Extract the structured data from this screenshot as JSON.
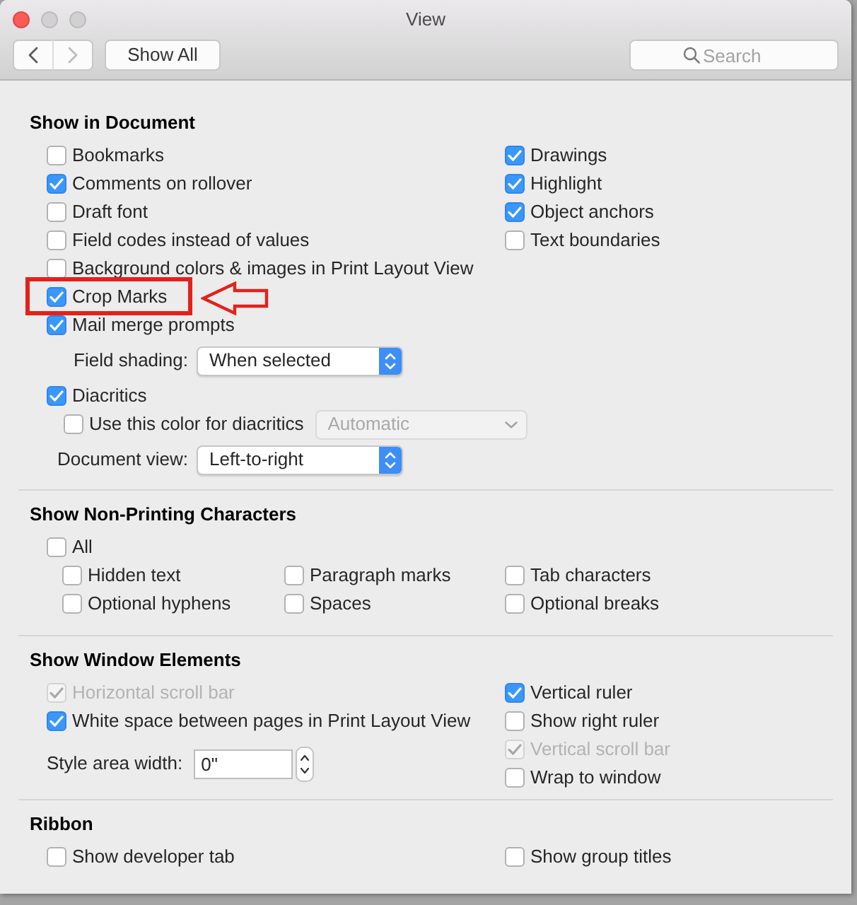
{
  "window": {
    "title": "View",
    "buttons": [
      {
        "kind": "close",
        "disabled": false
      },
      {
        "kind": "minimize",
        "disabled": true
      },
      {
        "kind": "zoom",
        "disabled": true
      }
    ]
  },
  "toolbar": {
    "nav_buttons": [
      {
        "kind": "back",
        "disabled": false
      },
      {
        "kind": "forward",
        "disabled": true
      }
    ],
    "show_all_button": "Show All",
    "search": {
      "placeholder": "Search"
    }
  },
  "sections": [
    {
      "title": "Show in Document",
      "left_items": [
        {
          "kind": "checkbox",
          "label": "Bookmarks",
          "checked": false,
          "highlighted": false
        },
        {
          "kind": "checkbox",
          "label": "Comments on rollover",
          "checked": true,
          "highlighted": false
        },
        {
          "kind": "checkbox",
          "label": "Draft font",
          "checked": false,
          "highlighted": false
        },
        {
          "kind": "checkbox",
          "label": "Field codes instead of values",
          "checked": false,
          "highlighted": false
        },
        {
          "kind": "checkbox",
          "label": "Background colors & images in Print Layout View",
          "checked": false,
          "highlighted": false
        },
        {
          "kind": "checkbox",
          "label": "Crop Marks",
          "checked": true,
          "highlighted": true
        },
        {
          "kind": "checkbox",
          "label": "Mail merge prompts",
          "checked": true,
          "highlighted": false
        },
        {
          "kind": "select",
          "label": "Field shading:",
          "value": "When selected",
          "highlighted": false
        },
        {
          "kind": "checkbox",
          "label": "Diacritics",
          "checked": true,
          "highlighted": false,
          "children": [
            {
              "kind": "checkbox_select",
              "label": "Use this color for diacritics",
              "checked": false,
              "select": {
                "value": "Automatic",
                "disabled": true
              }
            }
          ]
        },
        {
          "kind": "select",
          "label": "Document view:",
          "value": "Left-to-right",
          "highlighted": false
        }
      ],
      "right_items": [
        {
          "kind": "checkbox",
          "label": "Drawings",
          "checked": true
        },
        {
          "kind": "checkbox",
          "label": "Highlight",
          "checked": true
        },
        {
          "kind": "checkbox",
          "label": "Object anchors",
          "checked": true
        },
        {
          "kind": "checkbox",
          "label": "Text boundaries",
          "checked": false
        }
      ]
    },
    {
      "title": "Show Non-Printing Characters",
      "left_items": [
        {
          "kind": "checkbox",
          "label": "All",
          "checked": false,
          "children": [
            {
              "kind": "checkbox",
              "label": "Hidden text",
              "checked": false
            },
            {
              "kind": "checkbox",
              "label": "Paragraph marks",
              "checked": false
            },
            {
              "kind": "checkbox",
              "label": "Tab characters",
              "checked": false
            },
            {
              "kind": "checkbox",
              "label": "Optional hyphens",
              "checked": false
            },
            {
              "kind": "checkbox",
              "label": "Spaces",
              "checked": false
            },
            {
              "kind": "checkbox",
              "label": "Optional breaks",
              "checked": false
            }
          ]
        }
      ]
    },
    {
      "title": "Show Window Elements",
      "left_items": [
        {
          "kind": "checkbox",
          "label": "Horizontal scroll bar",
          "checked": true,
          "disabled": true
        },
        {
          "kind": "checkbox",
          "label": "White space between pages in Print Layout View",
          "checked": true,
          "disabled": false
        },
        {
          "kind": "stepper_field",
          "label": "Style area width:",
          "value": "0\""
        }
      ],
      "right_items": [
        {
          "kind": "checkbox",
          "label": "Vertical ruler",
          "checked": true,
          "disabled": false
        },
        {
          "kind": "checkbox",
          "label": "Show right ruler",
          "checked": false,
          "disabled": false
        },
        {
          "kind": "checkbox",
          "label": "Vertical scroll bar",
          "checked": true,
          "disabled": true
        },
        {
          "kind": "checkbox",
          "label": "Wrap to window",
          "checked": false,
          "disabled": false
        }
      ]
    },
    {
      "title": "Ribbon",
      "left_items": [
        {
          "kind": "checkbox",
          "label": "Show developer tab",
          "checked": false
        }
      ],
      "right_items": [
        {
          "kind": "checkbox",
          "label": "Show group titles",
          "checked": false
        }
      ]
    }
  ]
}
